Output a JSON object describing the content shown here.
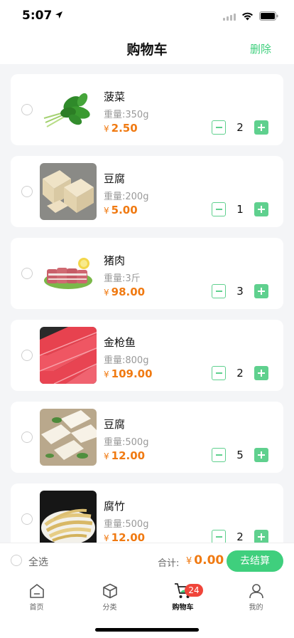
{
  "status_bar": {
    "time": "5:07"
  },
  "nav": {
    "title": "购物车",
    "delete_label": "删除"
  },
  "cart": {
    "items": [
      {
        "name": "菠菜",
        "weight": "重量:350g",
        "currency": "¥",
        "price": "2.50",
        "quantity": "2",
        "image_icon": "spinach-image"
      },
      {
        "name": "豆腐",
        "weight": "重量:200g",
        "currency": "¥",
        "price": "5.00",
        "quantity": "1",
        "image_icon": "tofu-image"
      },
      {
        "name": "猪肉",
        "weight": "重量:3斤",
        "currency": "¥",
        "price": "98.00",
        "quantity": "3",
        "image_icon": "pork-image"
      },
      {
        "name": "金枪鱼",
        "weight": "重量:800g",
        "currency": "¥",
        "price": "109.00",
        "quantity": "2",
        "image_icon": "tuna-image"
      },
      {
        "name": "豆腐",
        "weight": "重量:500g",
        "currency": "¥",
        "price": "12.00",
        "quantity": "5",
        "image_icon": "tofu-image"
      },
      {
        "name": "腐竹",
        "weight": "重量:500g",
        "currency": "¥",
        "price": "12.00",
        "quantity": "2",
        "image_icon": "yuba-image"
      }
    ]
  },
  "checkout": {
    "select_all_label": "全选",
    "total_label": "合计:",
    "currency": "¥",
    "total_amount": "0.00",
    "checkout_button": "去结算"
  },
  "tabs": {
    "items": [
      {
        "label": "首页",
        "icon": "home-icon"
      },
      {
        "label": "分类",
        "icon": "category-icon"
      },
      {
        "label": "购物车",
        "icon": "cart-icon",
        "badge": "24",
        "active": true
      },
      {
        "label": "我的",
        "icon": "profile-icon"
      }
    ]
  },
  "colors": {
    "accent": "#3fcf7d",
    "price": "#f07a12",
    "badge": "#f0453a",
    "background": "#f4f5f7"
  }
}
